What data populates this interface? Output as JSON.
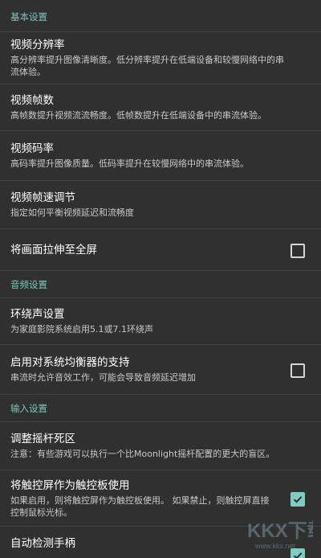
{
  "sections": {
    "basic": {
      "header": "基本设置",
      "resolution": {
        "title": "视频分辨率",
        "summary": "高分辨率提升图像清晰度。低分辨率提升在低端设备和较慢网络中的串流体验。"
      },
      "fps": {
        "title": "视频帧数",
        "summary": "高帧数提升视频流流畅度。低帧数提升在低端设备中的串流体验。"
      },
      "bitrate": {
        "title": "视频码率",
        "summary": "高码率提升图像质量。低码率提升在较慢网络中的串流体验。"
      },
      "frame_pacing": {
        "title": "视频帧速调节",
        "summary": "指定如何平衡视频延迟和流畅度"
      },
      "stretch": {
        "title": "将画面拉伸至全屏",
        "checked": false
      }
    },
    "audio": {
      "header": "音频设置",
      "surround": {
        "title": "环绕声设置",
        "summary": "为家庭影院系统启用5.1或7.1环绕声"
      },
      "equalizer": {
        "title": "启用对系统均衡器的支持",
        "summary": "串流时允许音效工作，可能会导致音频延迟增加",
        "checked": false
      }
    },
    "input": {
      "header": "输入设置",
      "deadzone": {
        "title": "调整摇杆死区",
        "summary": "注意：有些游戏可以执行一个比Moonlight摇杆配置的更大的盲区。"
      },
      "touchpad": {
        "title": "将触控屏作为触控板使用",
        "summary": "如果启用，则将触控屏作为触控板使用。 如果禁止，则触控屏直接控制鼠标光标。",
        "checked": true
      },
      "auto_gamepad": {
        "title": "自动检测手柄",
        "checked": true
      }
    }
  },
  "watermark": {
    "text": "KKX下载",
    "url": "www.kkx.net"
  },
  "colors": {
    "background": "#303030",
    "accent": "#80cbc4",
    "divider": "#404040"
  }
}
